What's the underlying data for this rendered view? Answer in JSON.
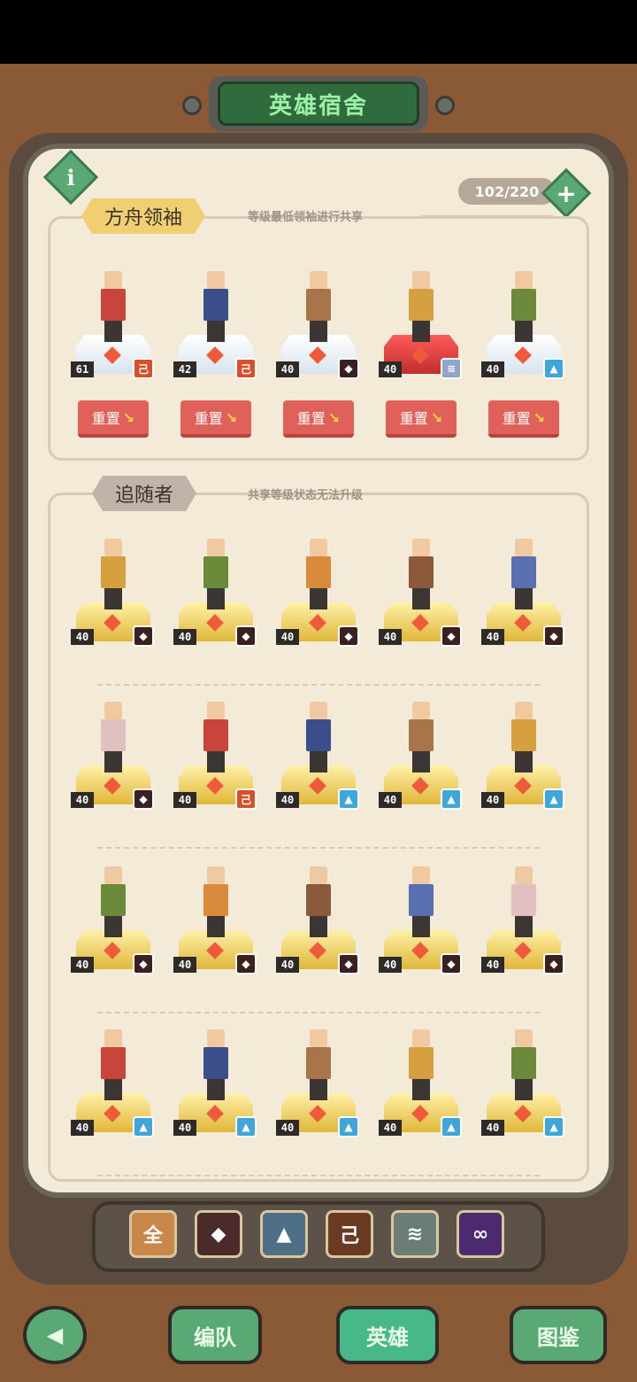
{
  "title": "英雄宿舍",
  "capacity": "102/220",
  "info_icon_label": "i",
  "add_icon_label": "+",
  "leaders_section": {
    "tag": "方舟领袖",
    "subtitle": "等级最低领袖进行共享",
    "reset_label": "重置",
    "heroes": [
      {
        "level": "61",
        "faction": "dragon",
        "faction_glyph": "己",
        "pedestal": "white"
      },
      {
        "level": "42",
        "faction": "dragon",
        "faction_glyph": "己",
        "pedestal": "white"
      },
      {
        "level": "40",
        "faction": "beast",
        "faction_glyph": "◆",
        "pedestal": "white"
      },
      {
        "level": "40",
        "faction": "claw",
        "faction_glyph": "≋",
        "pedestal": "red"
      },
      {
        "level": "40",
        "faction": "wolf",
        "faction_glyph": "▲",
        "pedestal": "white"
      }
    ]
  },
  "followers_section": {
    "tag": "追随者",
    "subtitle": "共享等级状态无法升级",
    "heroes": [
      {
        "level": "40",
        "faction": "beast",
        "faction_glyph": "◆"
      },
      {
        "level": "40",
        "faction": "beast",
        "faction_glyph": "◆"
      },
      {
        "level": "40",
        "faction": "beast",
        "faction_glyph": "◆"
      },
      {
        "level": "40",
        "faction": "beast",
        "faction_glyph": "◆"
      },
      {
        "level": "40",
        "faction": "beast",
        "faction_glyph": "◆"
      },
      {
        "level": "40",
        "faction": "beast",
        "faction_glyph": "◆"
      },
      {
        "level": "40",
        "faction": "dragon",
        "faction_glyph": "己"
      },
      {
        "level": "40",
        "faction": "wolf",
        "faction_glyph": "▲"
      },
      {
        "level": "40",
        "faction": "wolf",
        "faction_glyph": "▲"
      },
      {
        "level": "40",
        "faction": "wolf",
        "faction_glyph": "▲"
      },
      {
        "level": "40",
        "faction": "beast",
        "faction_glyph": "◆"
      },
      {
        "level": "40",
        "faction": "beast",
        "faction_glyph": "◆"
      },
      {
        "level": "40",
        "faction": "beast",
        "faction_glyph": "◆"
      },
      {
        "level": "40",
        "faction": "beast",
        "faction_glyph": "◆"
      },
      {
        "level": "40",
        "faction": "beast",
        "faction_glyph": "◆"
      },
      {
        "level": "40",
        "faction": "wolf",
        "faction_glyph": "▲"
      },
      {
        "level": "40",
        "faction": "wolf",
        "faction_glyph": "▲"
      },
      {
        "level": "40",
        "faction": "wolf",
        "faction_glyph": "▲"
      },
      {
        "level": "40",
        "faction": "wolf",
        "faction_glyph": "▲"
      },
      {
        "level": "40",
        "faction": "wolf",
        "faction_glyph": "▲"
      }
    ]
  },
  "filters": [
    {
      "name": "all",
      "glyph": "全",
      "color": "#c9874a"
    },
    {
      "name": "beast",
      "glyph": "◆",
      "color": "#4a2a2a"
    },
    {
      "name": "wolf",
      "glyph": "▲",
      "color": "#4f6f86"
    },
    {
      "name": "dragon",
      "glyph": "己",
      "color": "#6a3a22"
    },
    {
      "name": "claw",
      "glyph": "≋",
      "color": "#6a7d77"
    },
    {
      "name": "infinity",
      "glyph": "∞",
      "color": "#4b2a70"
    }
  ],
  "faction_colors": {
    "dragon": "#d8502b",
    "beast": "#3c2020",
    "claw": "#8fa6c9",
    "wolf": "#3ea6d8"
  },
  "bottom_nav": {
    "back_glyph": "◀",
    "team_label": "编队",
    "heroes_label": "英雄",
    "codex_label": "图鉴"
  }
}
